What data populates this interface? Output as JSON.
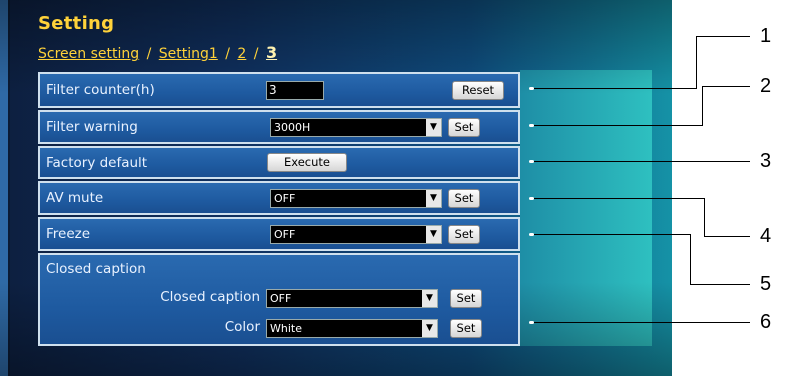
{
  "header": {
    "title": "Setting",
    "breadcrumb": {
      "screen_setting": "Screen setting",
      "separator": "/",
      "setting1": "Setting1",
      "page2": "2",
      "page3": "3"
    }
  },
  "rows": {
    "filter_counter": {
      "label": "Filter counter(h)",
      "value": "3",
      "button": "Reset"
    },
    "filter_warning": {
      "label": "Filter warning",
      "selected": "3000H",
      "button": "Set"
    },
    "factory_default": {
      "label": "Factory default",
      "button": "Execute"
    },
    "av_mute": {
      "label": "AV mute",
      "selected": "OFF",
      "button": "Set"
    },
    "freeze": {
      "label": "Freeze",
      "selected": "OFF",
      "button": "Set"
    },
    "closed_caption": {
      "label": "Closed caption",
      "cc_label": "Closed caption",
      "cc_selected": "OFF",
      "cc_button": "Set",
      "color_label": "Color",
      "color_selected": "White",
      "color_button": "Set"
    }
  },
  "callouts": [
    "1",
    "2",
    "3",
    "4",
    "5",
    "6"
  ],
  "icons": {
    "dropdown": "chevron-down-icon"
  },
  "colors": {
    "title": "#ffd23a",
    "row_bg": "#1e5aa0",
    "row_border": "#cfe0ee",
    "teal": "#2ec0c0"
  }
}
